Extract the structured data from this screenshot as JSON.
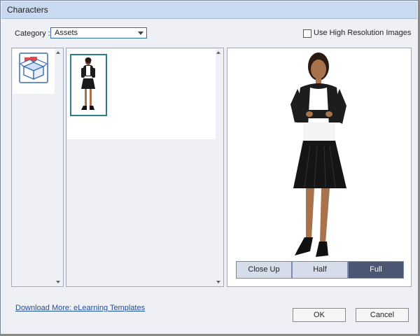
{
  "window": {
    "title": "Characters"
  },
  "category": {
    "label": "Category :",
    "value": "Assets"
  },
  "hires": {
    "label": "Use High Resolution Images",
    "checked": false
  },
  "view_buttons": [
    {
      "label": "Close Up",
      "selected": false
    },
    {
      "label": "Half",
      "selected": false
    },
    {
      "label": "Full",
      "selected": true
    }
  ],
  "footer": {
    "download_link": "Download More: eLearning Templates",
    "ok_label": "OK",
    "cancel_label": "Cancel"
  },
  "colors": {
    "title_bar": "#c9daf0",
    "accent": "#2f6fb6",
    "selected_view": "#4b5673",
    "thumb_border": "#2b7f86"
  },
  "icons": [
    "asset-box-icon",
    "dropdown-arrow-icon",
    "scroll-up-icon",
    "scroll-down-icon"
  ]
}
